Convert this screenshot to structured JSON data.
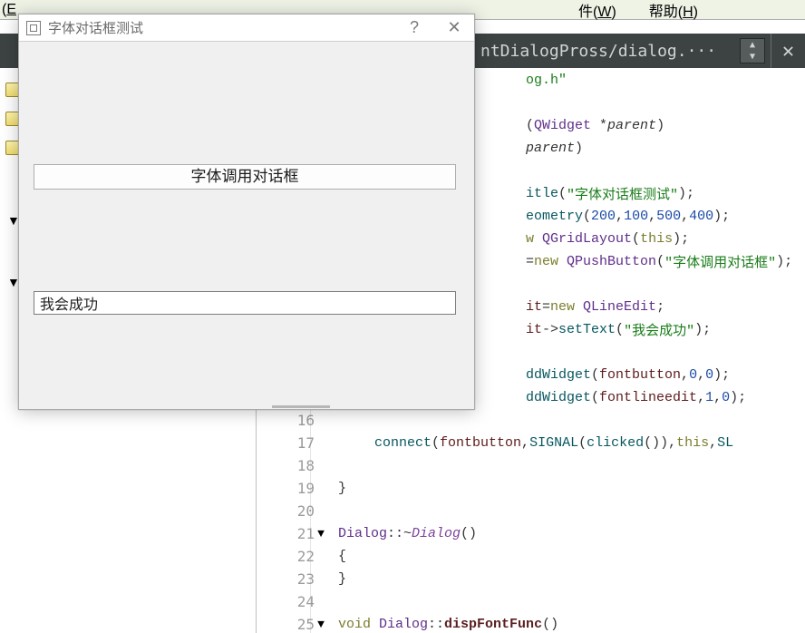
{
  "menubar": {
    "items": [
      {
        "prefix": "(",
        "key": "E",
        "suffix": ""
      },
      {
        "prefix": "件(",
        "key": "W",
        "suffix": ")"
      },
      {
        "prefix": "帮助(",
        "key": "H",
        "suffix": ")"
      }
    ]
  },
  "tabbar": {
    "label": "ntDialogPross/dialog.···",
    "arrows_top": "▲",
    "arrows_bot": "▼",
    "close": "✕"
  },
  "dialog": {
    "title": "字体对话框测试",
    "help": "?",
    "close": "✕",
    "button_label": "字体调用对话框",
    "edit_value": "我会成功"
  },
  "code": {
    "rows": [
      {
        "n": "",
        "fold": "",
        "indent": 0,
        "tokens": [
          [
            "c-pp",
            ""
          ],
          [
            "c-str",
            "og.h\""
          ]
        ]
      },
      {
        "n": "",
        "fold": "",
        "indent": 0,
        "tokens": []
      },
      {
        "n": "",
        "fold": "",
        "indent": 0,
        "tokens": [
          [
            "c-op",
            "("
          ],
          [
            "c-type",
            "QWidget"
          ],
          [
            "c-op",
            " *"
          ],
          [
            "c-ital",
            "parent"
          ],
          [
            "c-op",
            ")"
          ]
        ]
      },
      {
        "n": "",
        "fold": "",
        "indent": 0,
        "tokens": [
          [
            "c-ital",
            "parent"
          ],
          [
            "c-op",
            ")"
          ]
        ]
      },
      {
        "n": "",
        "fold": "",
        "indent": 0,
        "tokens": []
      },
      {
        "n": "",
        "fold": "",
        "indent": 0,
        "tokens": [
          [
            "c-fn",
            "itle"
          ],
          [
            "c-op",
            "("
          ],
          [
            "c-str",
            "\"字体对话框测试\""
          ],
          [
            "c-op",
            ");"
          ]
        ]
      },
      {
        "n": "",
        "fold": "",
        "indent": 0,
        "tokens": [
          [
            "c-fn",
            "eometry"
          ],
          [
            "c-op",
            "("
          ],
          [
            "c-num",
            "200"
          ],
          [
            "c-op",
            ","
          ],
          [
            "c-num",
            "100"
          ],
          [
            "c-op",
            ","
          ],
          [
            "c-num",
            "500"
          ],
          [
            "c-op",
            ","
          ],
          [
            "c-num",
            "400"
          ],
          [
            "c-op",
            ");"
          ]
        ]
      },
      {
        "n": "",
        "fold": "",
        "indent": 0,
        "tokens": [
          [
            "c-kw",
            "w "
          ],
          [
            "c-type",
            "QGridLayout"
          ],
          [
            "c-op",
            "("
          ],
          [
            "c-kw",
            "this"
          ],
          [
            "c-op",
            ");"
          ]
        ]
      },
      {
        "n": "",
        "fold": "",
        "indent": 0,
        "tokens": [
          [
            "c-op",
            "="
          ],
          [
            "c-kw",
            "new "
          ],
          [
            "c-type",
            "QPushButton"
          ],
          [
            "c-op",
            "("
          ],
          [
            "c-str",
            "\"字体调用对话框\""
          ],
          [
            "c-op",
            ");"
          ]
        ]
      },
      {
        "n": "",
        "fold": "",
        "indent": 0,
        "tokens": []
      },
      {
        "n": "",
        "fold": "",
        "indent": 0,
        "tokens": [
          [
            "c-mem",
            "it"
          ],
          [
            "c-op",
            "="
          ],
          [
            "c-kw",
            "new "
          ],
          [
            "c-type",
            "QLineEdit"
          ],
          [
            "c-op",
            ";"
          ]
        ]
      },
      {
        "n": "",
        "fold": "",
        "indent": 0,
        "tokens": [
          [
            "c-mem",
            "it"
          ],
          [
            "c-op",
            "->"
          ],
          [
            "c-fn",
            "setText"
          ],
          [
            "c-op",
            "("
          ],
          [
            "c-str",
            "\"我会成功\""
          ],
          [
            "c-op",
            ");"
          ]
        ]
      },
      {
        "n": "",
        "fold": "",
        "indent": 0,
        "tokens": []
      },
      {
        "n": "",
        "fold": "",
        "indent": 0,
        "tokens": [
          [
            "c-fn",
            "ddWidget"
          ],
          [
            "c-op",
            "("
          ],
          [
            "c-mem",
            "fontbutton"
          ],
          [
            "c-op",
            ","
          ],
          [
            "c-num",
            "0"
          ],
          [
            "c-op",
            ","
          ],
          [
            "c-num",
            "0"
          ],
          [
            "c-op",
            ");"
          ]
        ]
      },
      {
        "n": "",
        "fold": "",
        "indent": 0,
        "tokens": [
          [
            "c-fn",
            "ddWidget"
          ],
          [
            "c-op",
            "("
          ],
          [
            "c-mem",
            "fontlineedit"
          ],
          [
            "c-op",
            ","
          ],
          [
            "c-num",
            "1"
          ],
          [
            "c-op",
            ","
          ],
          [
            "c-num",
            "0"
          ],
          [
            "c-op",
            ");"
          ]
        ]
      },
      {
        "n": "16",
        "fold": "",
        "indent": 0,
        "tokens": []
      },
      {
        "n": "17",
        "fold": "",
        "indent": 48,
        "tokens": [
          [
            "c-fn",
            "connect"
          ],
          [
            "c-op",
            "("
          ],
          [
            "c-mem",
            "fontbutton"
          ],
          [
            "c-op",
            ","
          ],
          [
            "c-fn",
            "SIGNAL"
          ],
          [
            "c-op",
            "("
          ],
          [
            "c-fn",
            "clicked"
          ],
          [
            "c-op",
            "()),"
          ],
          [
            "c-kw",
            "this"
          ],
          [
            "c-op",
            ","
          ],
          [
            "c-fn",
            "SL"
          ]
        ]
      },
      {
        "n": "18",
        "fold": "",
        "indent": 0,
        "tokens": []
      },
      {
        "n": "19",
        "fold": "",
        "indent": 8,
        "tokens": [
          [
            "c-op",
            "}"
          ]
        ]
      },
      {
        "n": "20",
        "fold": "",
        "indent": 0,
        "tokens": []
      },
      {
        "n": "21",
        "fold": "▼",
        "indent": 8,
        "tokens": [
          [
            "c-type",
            "Dialog"
          ],
          [
            "c-op",
            "::~"
          ],
          [
            "c-type2",
            "Dialog"
          ],
          [
            "c-op",
            "()"
          ]
        ]
      },
      {
        "n": "22",
        "fold": "",
        "indent": 8,
        "tokens": [
          [
            "c-op",
            "{"
          ]
        ]
      },
      {
        "n": "23",
        "fold": "",
        "indent": 8,
        "tokens": [
          [
            "c-op",
            "}"
          ]
        ]
      },
      {
        "n": "24",
        "fold": "",
        "indent": 0,
        "tokens": []
      },
      {
        "n": "25",
        "fold": "▼",
        "indent": 8,
        "tokens": [
          [
            "c-kw",
            "void "
          ],
          [
            "c-type",
            "Dialog"
          ],
          [
            "c-op",
            "::"
          ],
          [
            "c-fn-b",
            "dispFontFunc"
          ],
          [
            "c-op",
            "()"
          ]
        ]
      }
    ]
  }
}
